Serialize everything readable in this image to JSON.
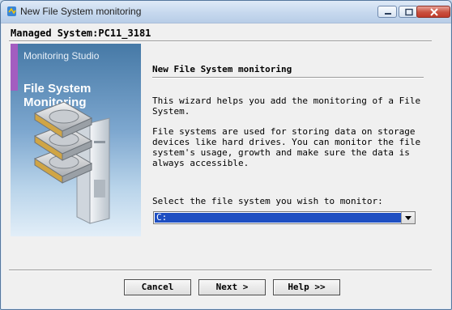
{
  "window": {
    "title": "New File System monitoring",
    "controls": [
      "minimize-icon",
      "maximize-icon",
      "close-icon"
    ]
  },
  "header": {
    "managed_system": "Managed System:PC11_3181"
  },
  "banner": {
    "product": "Monitoring Studio",
    "heading_line1": "File System",
    "heading_line2": "Monitoring",
    "accent_color": "#a35dc0"
  },
  "page": {
    "title": "New File System monitoring",
    "intro": "This wizard helps you add the monitoring of a File\nSystem.",
    "description": "File systems are used for storing data on storage\ndevices like hard drives. You can monitor the file\nsystem's usage, growth and make sure the data is\nalways accessible.",
    "select_label": "Select the file system you wish to monitor:",
    "selected_value": "C:"
  },
  "buttons": {
    "cancel": "Cancel",
    "next": "Next >",
    "help": "Help >>"
  },
  "colors": {
    "selection": "#1f4fc2",
    "titlebar": "#c6d8ee"
  }
}
